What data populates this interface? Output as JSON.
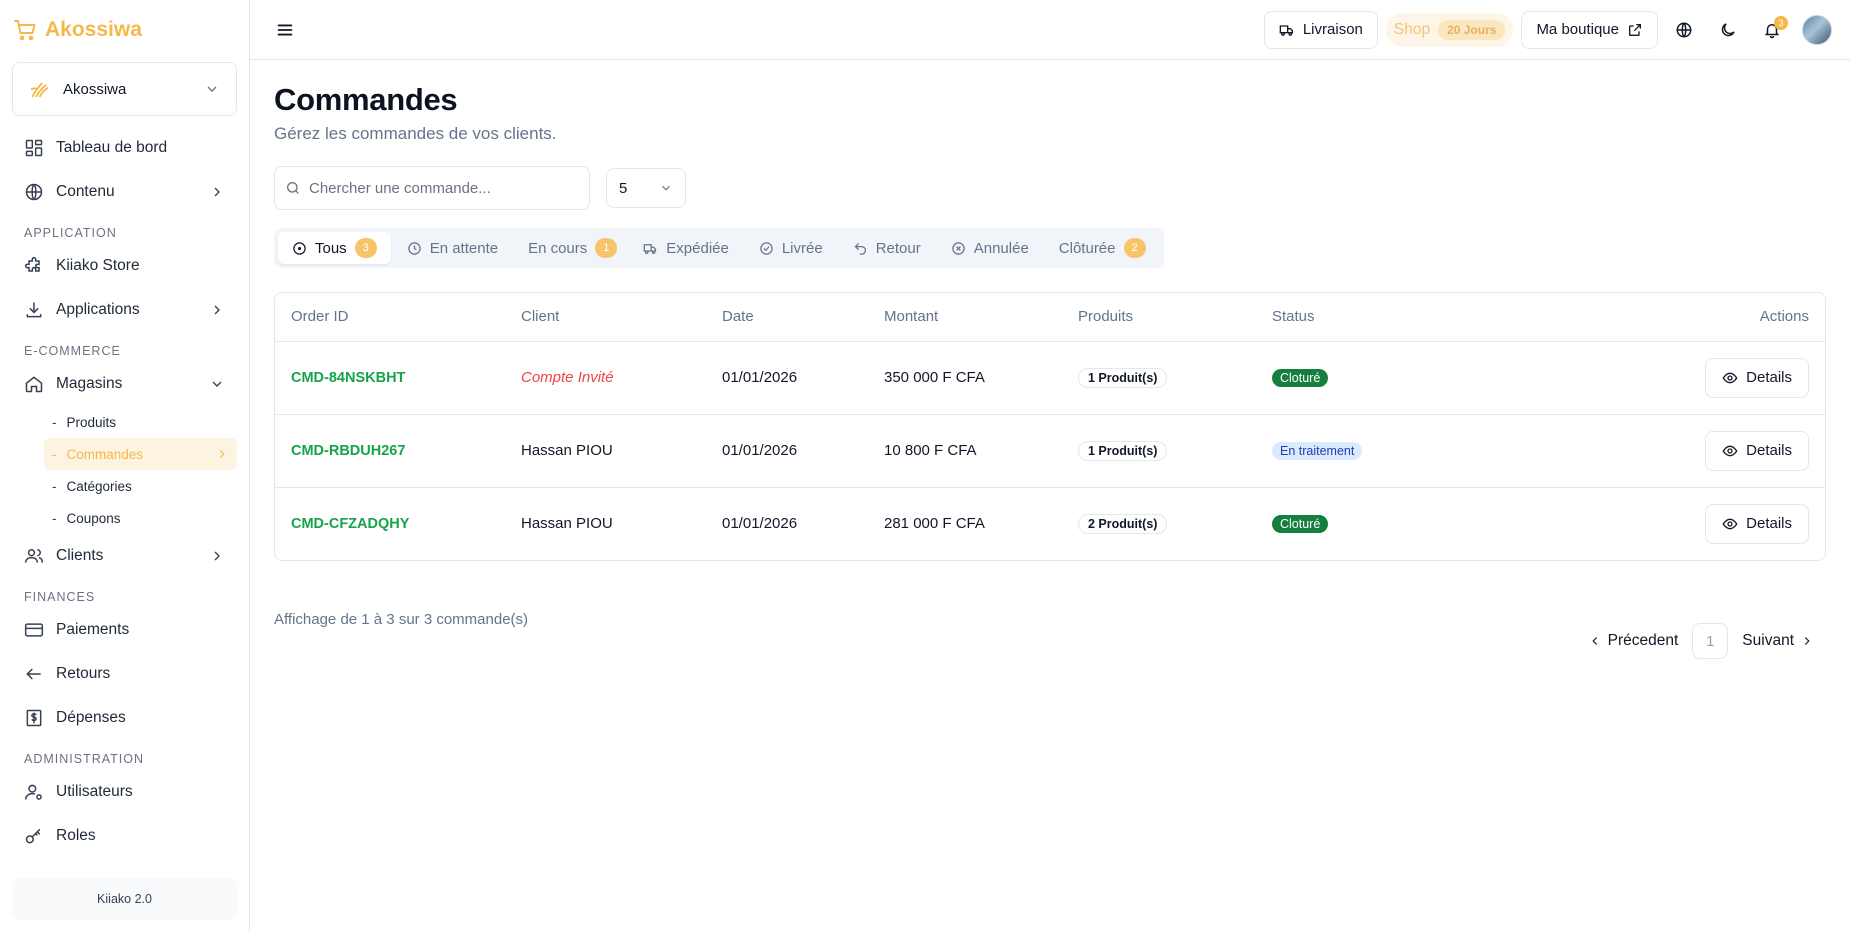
{
  "brand": {
    "name": "Akossiwa",
    "icon": "cart-icon",
    "color": "#f6b84b"
  },
  "store_selector": {
    "name": "Akossiwa"
  },
  "sidebar": {
    "items": [
      {
        "label": "Tableau de bord",
        "icon": "dashboard-icon"
      },
      {
        "label": "Contenu",
        "icon": "globe-icon"
      }
    ],
    "sections": {
      "application": "APPLICATION",
      "ecommerce": "E-COMMERCE",
      "finances": "FINANCES",
      "administration": "ADMINISTRATION"
    },
    "app_items": [
      {
        "label": "Kiiako Store",
        "icon": "puzzle-icon"
      },
      {
        "label": "Applications",
        "icon": "download-icon"
      }
    ],
    "magasins": {
      "label": "Magasins",
      "icon": "home-icon",
      "sub": [
        "Produits",
        "Commandes",
        "Catégories",
        "Coupons"
      ],
      "active": "Commandes"
    },
    "clients": {
      "label": "Clients",
      "icon": "users-icon"
    },
    "finance_items": [
      {
        "label": "Paiements",
        "icon": "card-icon"
      },
      {
        "label": "Retours",
        "icon": "arrow-left-icon"
      },
      {
        "label": "Dépenses",
        "icon": "dollar-icon"
      }
    ],
    "admin_items": [
      {
        "label": "Utilisateurs",
        "icon": "user-cog-icon"
      },
      {
        "label": "Roles",
        "icon": "key-icon"
      }
    ],
    "version": "Kiiako 2.0"
  },
  "topbar": {
    "livraison": "Livraison",
    "shop": "Shop",
    "shop_days": "20 Jours",
    "ma_boutique": "Ma boutique",
    "notif_count": "3"
  },
  "page": {
    "title": "Commandes",
    "subtitle": "Gérez les commandes de vos clients."
  },
  "search": {
    "placeholder": "Chercher une commande..."
  },
  "per_page": "5",
  "tabs": [
    {
      "label": "Tous",
      "count": "3"
    },
    {
      "label": "En attente",
      "count": ""
    },
    {
      "label": "En cours",
      "count": "1"
    },
    {
      "label": "Expédiée",
      "count": ""
    },
    {
      "label": "Livrée",
      "count": ""
    },
    {
      "label": "Retour",
      "count": ""
    },
    {
      "label": "Annulée",
      "count": ""
    },
    {
      "label": "Clôturée",
      "count": "2"
    }
  ],
  "table": {
    "headers": [
      "Order ID",
      "Client",
      "Date",
      "Montant",
      "Produits",
      "Status",
      "Actions"
    ],
    "rows": [
      {
        "id": "CMD-84NSKBHT",
        "client": "Compte Invité",
        "date": "01/01/2026",
        "montant": "350 000 F CFA",
        "produits": "1 Produit(s)",
        "status": "Cloturé",
        "action": "Details"
      },
      {
        "id": "CMD-RBDUH267",
        "client": "Hassan PIOU",
        "date": "01/01/2026",
        "montant": "10 800 F CFA",
        "produits": "1 Produit(s)",
        "status": "En traitement",
        "action": "Details"
      },
      {
        "id": "CMD-CFZADQHY",
        "client": "Hassan PIOU",
        "date": "01/01/2026",
        "montant": "281 000 F CFA",
        "produits": "2 Produit(s)",
        "status": "Cloturé",
        "action": "Details"
      }
    ]
  },
  "footer": {
    "showing": "Affichage de 1 à 3 sur 3 commande(s)",
    "prev": "Précedent",
    "page": "1",
    "next": "Suivant"
  }
}
